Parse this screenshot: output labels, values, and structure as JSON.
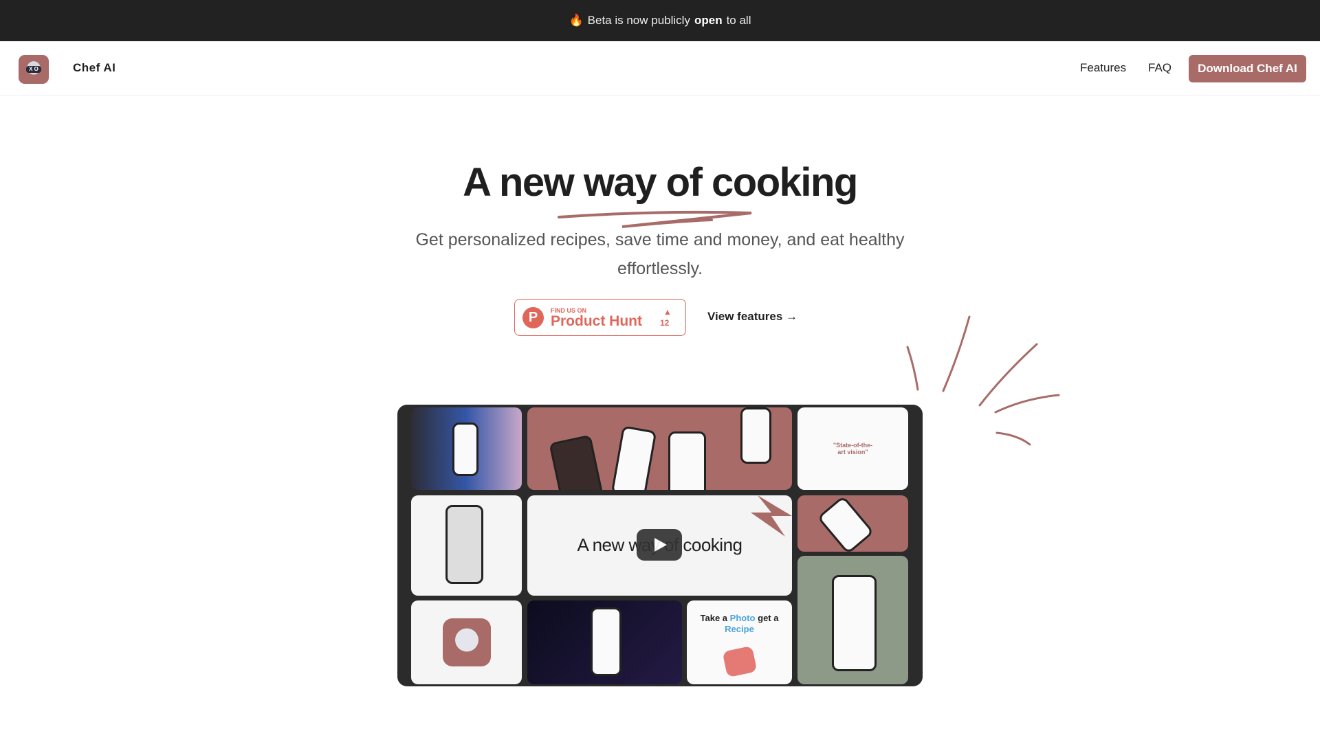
{
  "banner": {
    "emoji": "🔥",
    "text_before": "Beta is now publicly",
    "text_bold": "open",
    "text_after": "to all"
  },
  "nav": {
    "brand": "Chef AI",
    "links": [
      "Features",
      "FAQ"
    ],
    "cta": "Download Chef AI"
  },
  "hero": {
    "title": "A new way of cooking",
    "subtitle": "Get personalized recipes, save time and money, and eat healthy effortlessly."
  },
  "product_hunt": {
    "small": "FIND US ON",
    "big": "Product Hunt",
    "icon": "P",
    "upvotes": "12"
  },
  "view_features": "View features →",
  "video": {
    "title": "A new way of cooking",
    "tagline_before": "Take a",
    "tagline_photo": "Photo",
    "tagline_after": "get a",
    "tagline_recipe": "Recipe",
    "quote": "\"State-of-the-art vision\"",
    "accent": "#a86b68"
  }
}
